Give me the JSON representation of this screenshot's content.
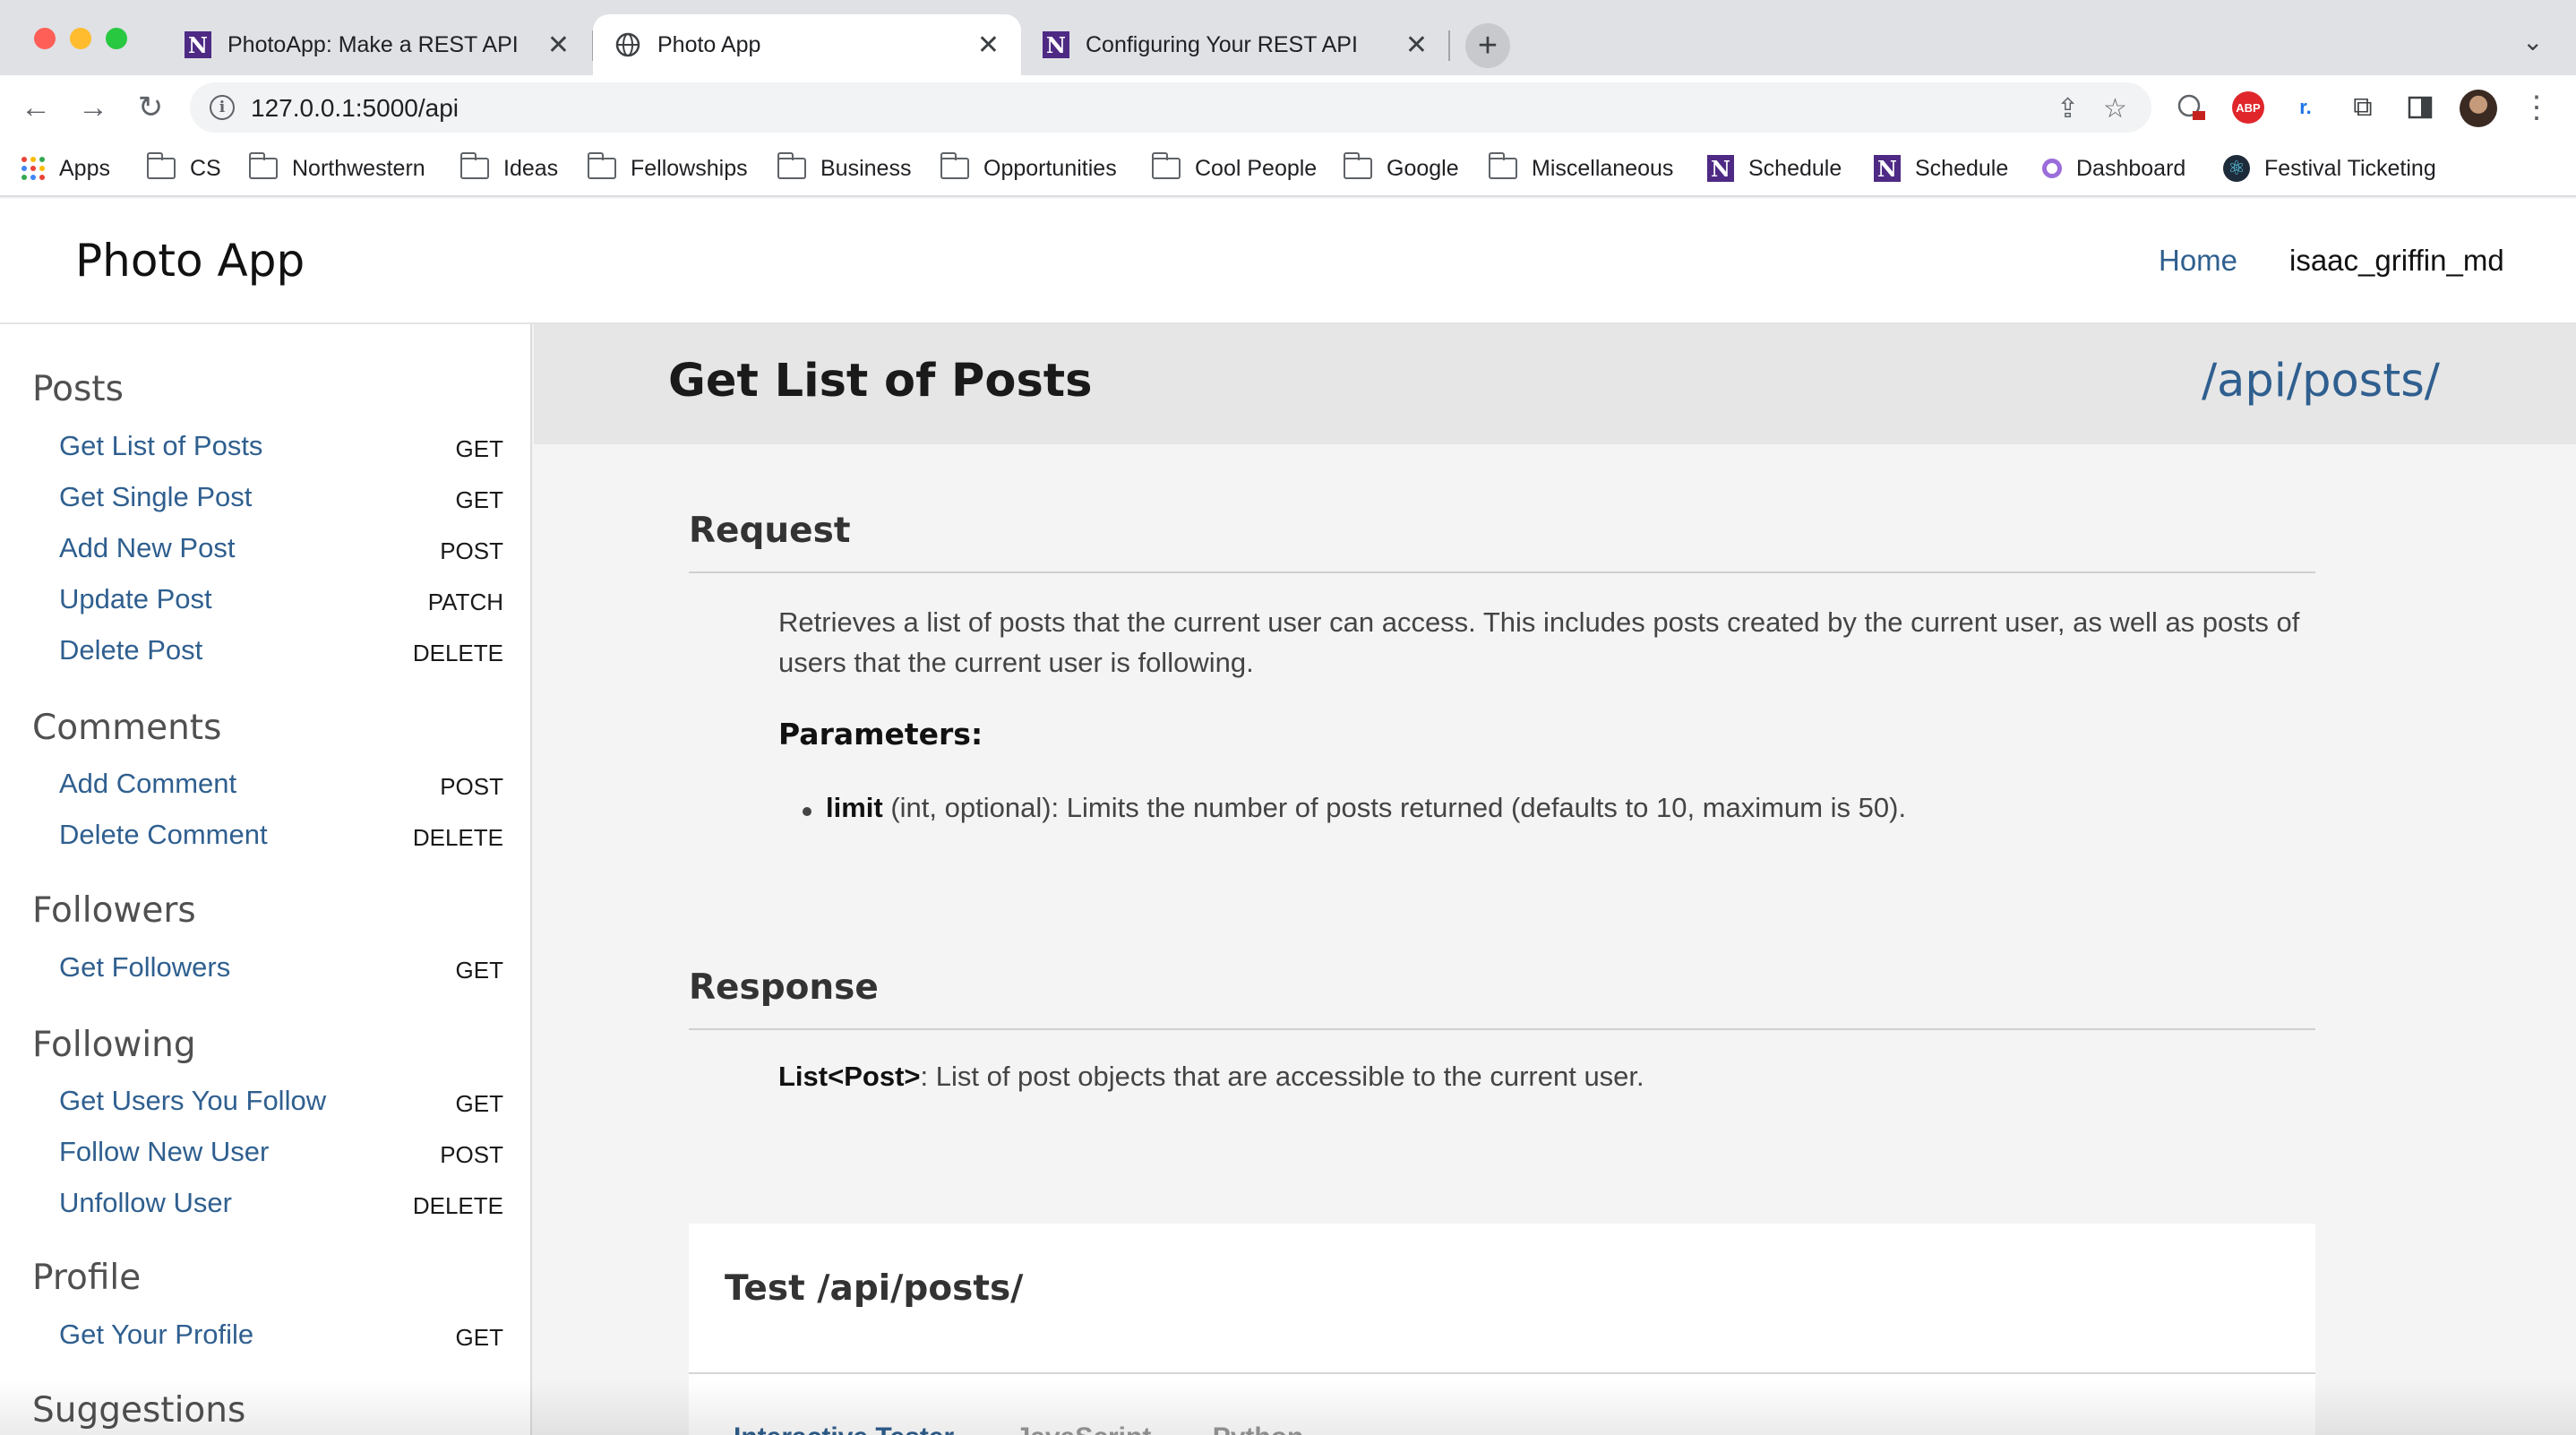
{
  "browser": {
    "tabs": [
      {
        "title": "PhotoApp: Make a REST API",
        "favicon": "n-logo-icon"
      },
      {
        "title": "Photo App",
        "favicon": "globe-icon",
        "active": true
      },
      {
        "title": "Configuring Your REST API",
        "favicon": "n-logo-icon"
      }
    ],
    "url": "127.0.0.1:5000/api",
    "bookmarks": [
      "Apps",
      "CS",
      "Northwestern",
      "Ideas",
      "Fellowships",
      "Business",
      "Opportunities",
      "Cool People",
      "Google",
      "Miscellaneous",
      "Schedule",
      "Schedule",
      "Dashboard",
      "Festival Ticketing"
    ],
    "n_logo_letter": "N",
    "extension_abp": "ABP",
    "extension_r": "r."
  },
  "app": {
    "brand": "Photo App",
    "nav": {
      "home": "Home",
      "user": "isaac_griffin_md"
    }
  },
  "sidebar": {
    "sections": [
      {
        "heading": "Posts",
        "items": [
          {
            "label": "Get List of Posts",
            "method": "GET"
          },
          {
            "label": "Get Single Post",
            "method": "GET"
          },
          {
            "label": "Add New Post",
            "method": "POST"
          },
          {
            "label": "Update Post",
            "method": "PATCH"
          },
          {
            "label": "Delete Post",
            "method": "DELETE"
          }
        ]
      },
      {
        "heading": "Comments",
        "items": [
          {
            "label": "Add Comment",
            "method": "POST"
          },
          {
            "label": "Delete Comment",
            "method": "DELETE"
          }
        ]
      },
      {
        "heading": "Followers",
        "items": [
          {
            "label": "Get Followers",
            "method": "GET"
          }
        ]
      },
      {
        "heading": "Following",
        "items": [
          {
            "label": "Get Users You Follow",
            "method": "GET"
          },
          {
            "label": "Follow New User",
            "method": "POST"
          },
          {
            "label": "Unfollow User",
            "method": "DELETE"
          }
        ]
      },
      {
        "heading": "Profile",
        "items": [
          {
            "label": "Get Your Profile",
            "method": "GET"
          }
        ]
      },
      {
        "heading": "Suggestions",
        "items": []
      }
    ]
  },
  "main": {
    "title": "Get List of Posts",
    "endpoint": "/api/posts/",
    "request": {
      "heading": "Request",
      "description": "Retrieves a list of posts that the current user can access. This includes posts created by the current user, as well as posts of users that the current user is following.",
      "params_heading": "Parameters:",
      "params": [
        {
          "name": "limit",
          "desc": " (int, optional): Limits the number of posts returned (defaults to 10, maximum is 50)."
        }
      ]
    },
    "response": {
      "heading": "Response",
      "type": "List<Post>",
      "desc": ": List of post objects that are accessible to the current user."
    },
    "test": {
      "title": "Test /api/posts/",
      "tabs": [
        "Interactive Tester",
        "JavaScript",
        "Python"
      ]
    }
  },
  "colors": {
    "link": "#2f5f8f",
    "sidebar_bg": "#ffffff",
    "main_bg": "#f4f4f4",
    "titlebar_bg": "#e6e6e6"
  }
}
